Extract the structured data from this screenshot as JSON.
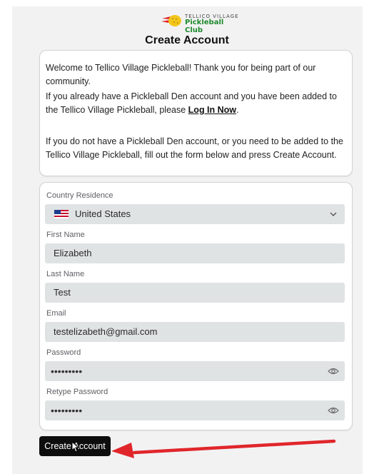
{
  "logo": {
    "line1": "TELLICO VILLAGE",
    "line2": "Pickleball Club"
  },
  "page_title": "Create Account",
  "info": {
    "p1": "Welcome to Tellico Village Pickleball! Thank you for being part of our community.",
    "p2_before": "If you already have a Pickleball Den account and you have been added to the Tellico Village Pickleball, please ",
    "p2_link": "Log In Now",
    "p2_after": ".",
    "p3": "If you do not have a Pickleball Den account, or you need to be added to the Tellico Village Pickleball, fill out the form below and press Create Account."
  },
  "form": {
    "country_label": "Country Residence",
    "country_value": "United States",
    "first_name_label": "First Name",
    "first_name_value": "Elizabeth",
    "last_name_label": "Last Name",
    "last_name_value": "Test",
    "email_label": "Email",
    "email_value": "testelizabeth@gmail.com",
    "password_label": "Password",
    "password_value": "•••••••••",
    "retype_label": "Retype Password",
    "retype_value": "•••••••••"
  },
  "create_button": "Create Account",
  "colors": {
    "annotation_arrow": "#e0262b",
    "button_bg": "#0d0d0d",
    "field_bg": "#dfe3e4"
  },
  "icons": [
    "pickleball-logo-icon",
    "us-flag-icon",
    "chevron-down-icon",
    "eye-icon",
    "eye-icon",
    "mouse-cursor-icon",
    "annotation-arrow-icon"
  ]
}
